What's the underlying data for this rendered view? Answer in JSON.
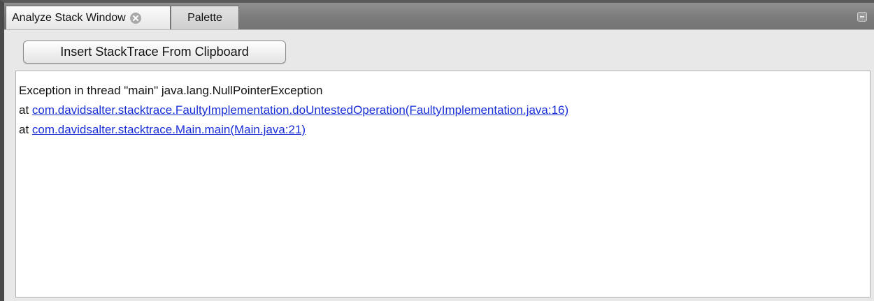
{
  "tabs": [
    {
      "label": "Analyze Stack Window",
      "active": true
    },
    {
      "label": "Palette",
      "active": false
    }
  ],
  "toolbar": {
    "insert_label": "Insert StackTrace From Clipboard"
  },
  "output": {
    "exception_line": "Exception in thread \"main\" java.lang.NullPointerException",
    "frames": [
      {
        "prefix": "at ",
        "link": "com.davidsalter.stacktrace.FaultyImplementation.doUntestedOperation(FaultyImplementation.java:16)"
      },
      {
        "prefix": "at ",
        "link": "com.davidsalter.stacktrace.Main.main(Main.java:21)"
      }
    ]
  },
  "colors": {
    "link": "#1a2ed6",
    "tabbar": "#7c7c7c",
    "panel": "#e8e8e8"
  },
  "icons": {
    "tab_close": "close-icon",
    "window_minimize": "minimize-icon"
  }
}
